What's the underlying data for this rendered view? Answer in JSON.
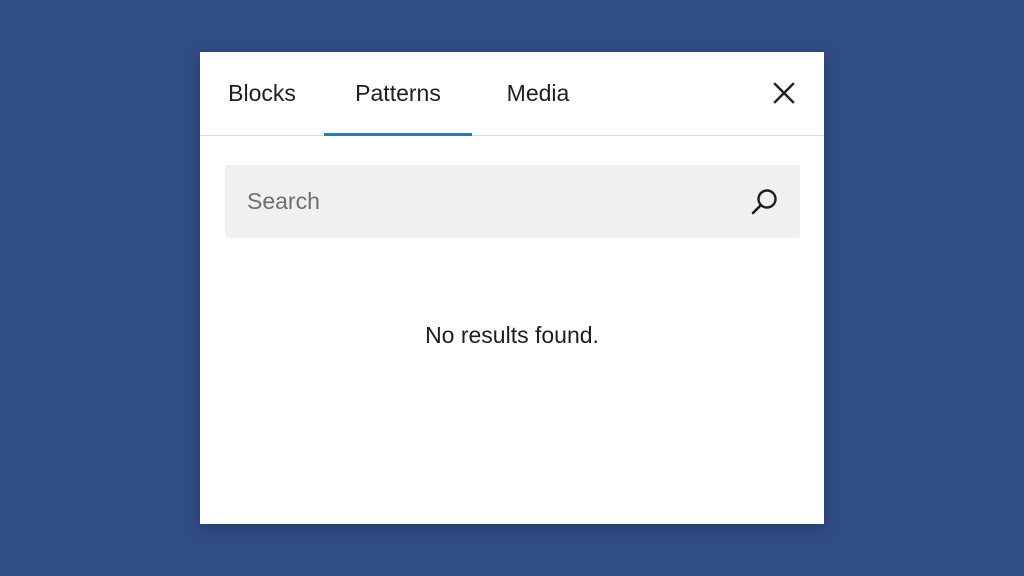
{
  "tabs": {
    "blocks": "Blocks",
    "patterns": "Patterns",
    "media": "Media",
    "active": "patterns"
  },
  "close": {
    "icon": "close-icon"
  },
  "search": {
    "placeholder": "Search",
    "value": "",
    "icon": "search-icon"
  },
  "results": {
    "empty_message": "No results found."
  },
  "colors": {
    "background": "#314d86",
    "panel": "#ffffff",
    "accent": "#2b7bb9",
    "search_bg": "#f0f0f0",
    "text": "#1e1e1e"
  }
}
